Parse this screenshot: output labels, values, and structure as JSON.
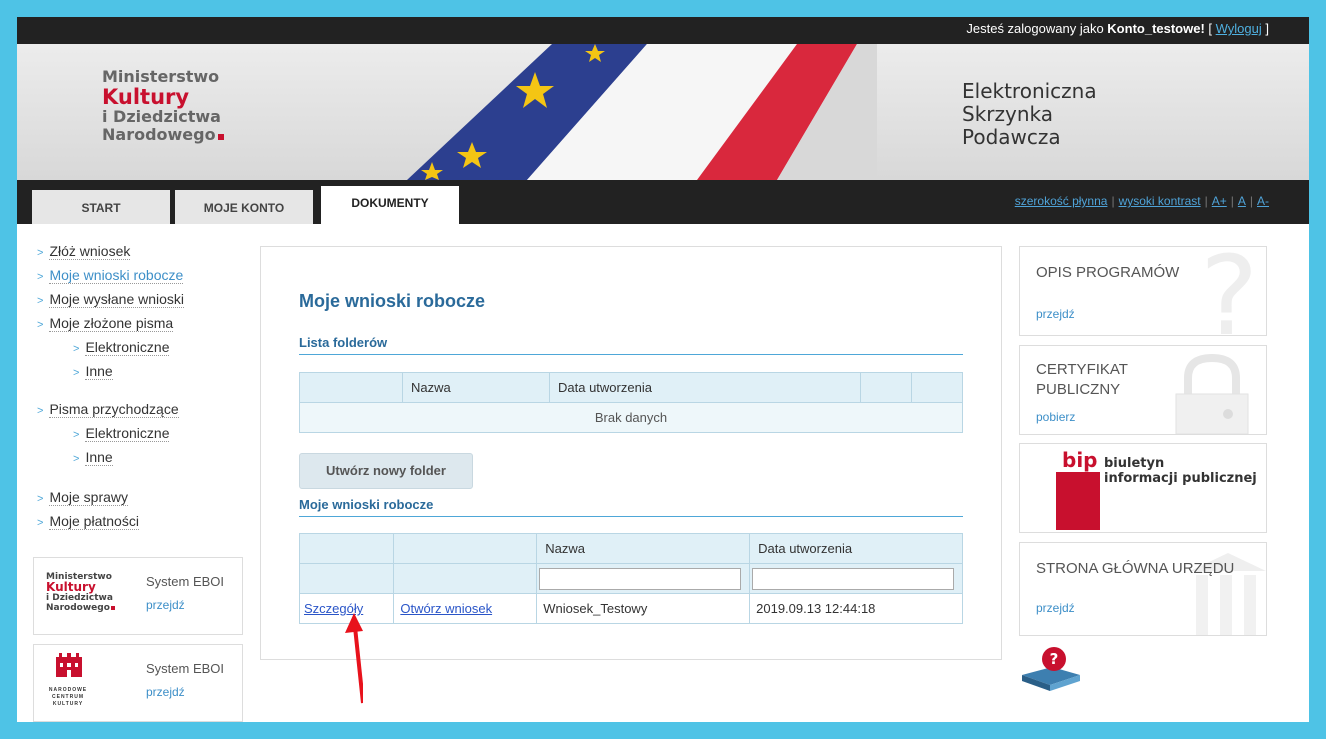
{
  "topbar": {
    "login_prefix": "Jesteś zalogowany jako ",
    "username": "Konto_testowe!",
    "bracket_open": " [ ",
    "logout_label": "Wyloguj",
    "bracket_close": " ]"
  },
  "header": {
    "ministry_line1": "Ministerstwo",
    "ministry_line2": "Kultury",
    "ministry_line3": "i Dziedzictwa",
    "ministry_line4": "Narodowego",
    "app_title_line1": "Elektroniczna",
    "app_title_line2": "Skrzynka",
    "app_title_line3": "Podawcza"
  },
  "tabs": [
    {
      "label": "START"
    },
    {
      "label": "MOJE KONTO"
    },
    {
      "label": "DOKUMENTY"
    }
  ],
  "accessibility": {
    "fluid_width": "szerokość płynna",
    "high_contrast": "wysoki kontrast",
    "font_larger": "A+",
    "font_normal": "A",
    "font_smaller": "A-"
  },
  "sidebar": {
    "items": [
      {
        "label": "Złóż wniosek"
      },
      {
        "label": "Moje wnioski robocze"
      },
      {
        "label": "Moje wysłane wnioski"
      },
      {
        "label": "Moje złożone pisma"
      },
      {
        "label": "Elektroniczne"
      },
      {
        "label": "Inne"
      },
      {
        "label": "Pisma przychodzące"
      },
      {
        "label": "Elektroniczne"
      },
      {
        "label": "Inne"
      },
      {
        "label": "Moje sprawy"
      },
      {
        "label": "Moje płatności"
      }
    ],
    "eboi_boxes": [
      {
        "name": "System EBOI",
        "link": "przejdź"
      },
      {
        "name": "System EBOI",
        "link": "przejdź"
      }
    ],
    "nck_logo_text": "NARODOWE CENTRUM KULTURY"
  },
  "main": {
    "page_title": "Moje wnioski robocze",
    "folders_title": "Lista folderów",
    "folders_table": {
      "headers": [
        "",
        "Nazwa",
        "Data utworzenia",
        "",
        ""
      ],
      "empty_text": "Brak danych"
    },
    "new_folder_button": "Utwórz nowy folder",
    "drafts_title": "Moje wnioski robocze",
    "drafts_table": {
      "headers": [
        "",
        "",
        "Nazwa",
        "Data utworzenia"
      ],
      "rows": [
        {
          "details": "Szczegóły",
          "open": "Otwórz wniosek",
          "name": "Wniosek_Testowy",
          "date": "2019.09.13 12:44:18"
        }
      ]
    }
  },
  "right_panel": {
    "programs": {
      "title": "OPIS PROGRAMÓW",
      "link": "przejdź"
    },
    "certificate": {
      "title_line1": "CERTYFIKAT",
      "title_line2": "PUBLICZNY",
      "link": "pobierz"
    },
    "bip": {
      "logo": "bip",
      "line1": "biuletyn",
      "line2": "informacji publicznej"
    },
    "homepage": {
      "title": "STRONA GŁÓWNA URZĘDU",
      "link": "przejdź"
    }
  },
  "colors": {
    "accent_blue": "#2a6a9a",
    "link_blue": "#3d8fc8",
    "brand_red": "#c8102e",
    "frame_cyan": "#4ec3e6"
  }
}
